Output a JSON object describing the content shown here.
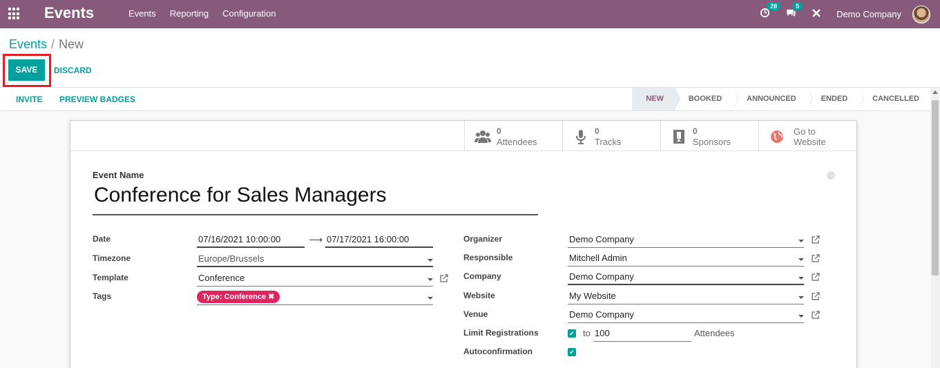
{
  "navbar": {
    "app_name": "Events",
    "menu": [
      "Events",
      "Reporting",
      "Configuration"
    ],
    "activity_count": "28",
    "message_count": "5",
    "company": "Demo Company"
  },
  "breadcrumb": {
    "parent": "Events",
    "current": "New"
  },
  "buttons": {
    "save": "SAVE",
    "discard": "DISCARD",
    "invite": "INVITE",
    "preview_badges": "PREVIEW BADGES"
  },
  "stages": [
    "NEW",
    "BOOKED",
    "ANNOUNCED",
    "ENDED",
    "CANCELLED"
  ],
  "active_stage": "NEW",
  "smart_buttons": {
    "attendees": {
      "count": "0",
      "label": "Attendees"
    },
    "tracks": {
      "count": "0",
      "label": "Tracks"
    },
    "sponsors": {
      "count": "0",
      "label": "Sponsors"
    },
    "website": {
      "line1": "Go to",
      "line2": "Website"
    }
  },
  "form": {
    "event_name_label": "Event Name",
    "event_name": "Conference for Sales Managers",
    "left": {
      "date_label": "Date",
      "date_start": "07/16/2021 10:00:00",
      "date_end": "07/17/2021 16:00:00",
      "timezone_label": "Timezone",
      "timezone": "Europe/Brussels",
      "template_label": "Template",
      "template": "Conference",
      "tags_label": "Tags",
      "tag": "Type: Conference"
    },
    "right": {
      "organizer_label": "Organizer",
      "organizer": "Demo Company",
      "responsible_label": "Responsible",
      "responsible": "Mitchell Admin",
      "company_label": "Company",
      "company": "Demo Company",
      "website_label": "Website",
      "website": "My Website",
      "venue_label": "Venue",
      "venue": "Demo Company",
      "limit_label": "Limit Registrations",
      "limit_to": "to",
      "limit_value": "100",
      "limit_unit": "Attendees",
      "autoconfirm_label": "Autoconfirmation"
    }
  },
  "colors": {
    "brand": "#875a7b",
    "accent": "#00a09d",
    "tag": "#e0245e",
    "highlight": "#e31e24"
  }
}
